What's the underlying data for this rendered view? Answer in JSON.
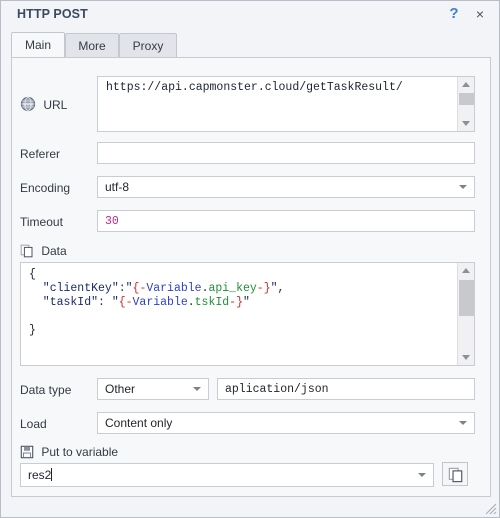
{
  "window": {
    "title": "HTTP POST",
    "help_label": "?",
    "close_label": "×"
  },
  "tabs": [
    {
      "label": "Main",
      "active": true
    },
    {
      "label": "More",
      "active": false
    },
    {
      "label": "Proxy",
      "active": false
    }
  ],
  "fields": {
    "url": {
      "label": "URL",
      "icon": "globe-www-icon",
      "value": "https://api.capmonster.cloud/getTaskResult/"
    },
    "referer": {
      "label": "Referer",
      "value": ""
    },
    "encoding": {
      "label": "Encoding",
      "value": "utf-8"
    },
    "timeout": {
      "label": "Timeout",
      "value": "30"
    },
    "data": {
      "label": "Data",
      "icon": "copy-pages-icon",
      "lines": [
        {
          "tokens": [
            {
              "t": "{",
              "c": "s-punct"
            }
          ]
        },
        {
          "tokens": [
            {
              "t": "  \"clientKey\":\"",
              "c": "s-key"
            },
            {
              "t": "{",
              "c": "s-brace"
            },
            {
              "t": "-",
              "c": "s-dash"
            },
            {
              "t": "Variable",
              "c": "s-var"
            },
            {
              "t": ".",
              "c": "s-punct"
            },
            {
              "t": "api_key",
              "c": "s-mod"
            },
            {
              "t": "-",
              "c": "s-dash"
            },
            {
              "t": "}",
              "c": "s-brace"
            },
            {
              "t": "\",",
              "c": "s-key"
            }
          ]
        },
        {
          "tokens": [
            {
              "t": "  \"taskId\": \"",
              "c": "s-key"
            },
            {
              "t": "{",
              "c": "s-brace"
            },
            {
              "t": "-",
              "c": "s-dash"
            },
            {
              "t": "Variable",
              "c": "s-var"
            },
            {
              "t": ".",
              "c": "s-punct"
            },
            {
              "t": "tskId",
              "c": "s-mod"
            },
            {
              "t": "-",
              "c": "s-dash"
            },
            {
              "t": "}",
              "c": "s-brace"
            },
            {
              "t": "\"",
              "c": "s-key"
            }
          ]
        },
        {
          "tokens": []
        },
        {
          "tokens": [
            {
              "t": "}",
              "c": "s-punct"
            }
          ]
        }
      ]
    },
    "data_type": {
      "label": "Data type",
      "select_value": "Other",
      "text_value": "aplication/json"
    },
    "load": {
      "label": "Load",
      "value": "Content only"
    },
    "put_to_variable": {
      "label": "Put to variable",
      "icon": "save-floppy-icon",
      "value": "res2",
      "copy_icon": "copy-pages-icon"
    }
  },
  "colors": {
    "accent_blue": "#3f7fd0",
    "title_text": "#3b4a5e",
    "panel_bg": "#f7f8fa",
    "window_bg": "#f3f4f7",
    "number_magenta": "#c0268c",
    "var_blue": "#2d3fcb",
    "var_green": "#1f8f3a",
    "brace_red": "#d12a2a",
    "json_key_navy": "#1b2a6b"
  }
}
